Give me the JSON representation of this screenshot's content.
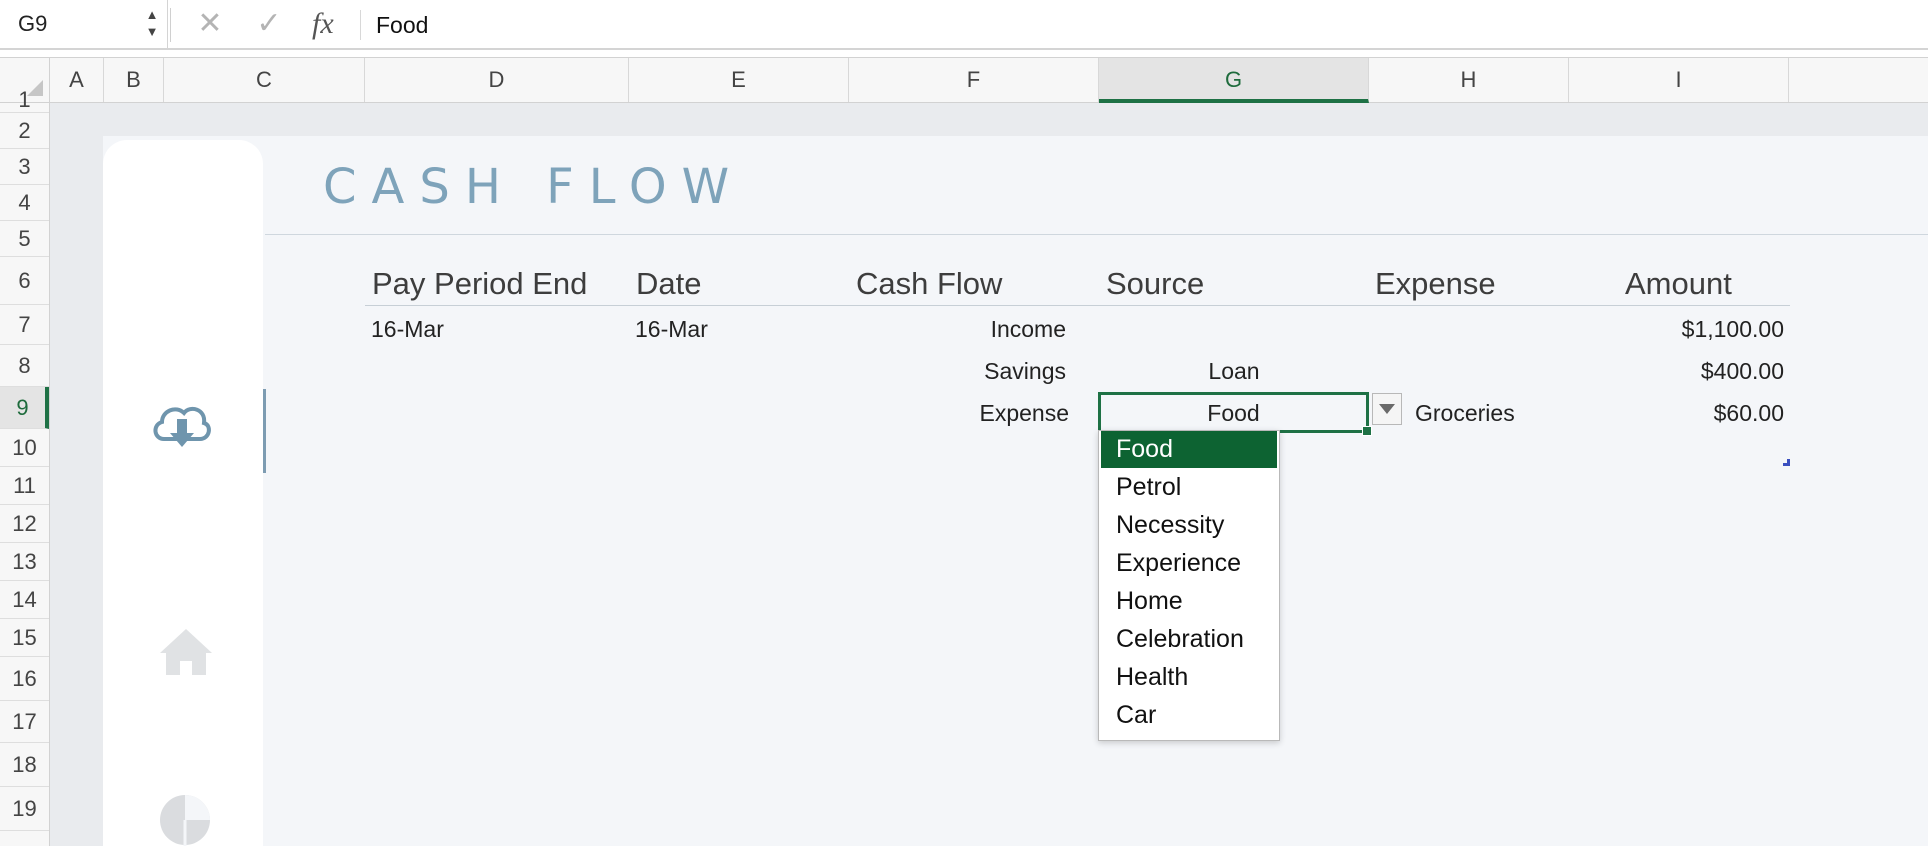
{
  "formula_bar": {
    "name_box": "G9",
    "cancel_icon": "close-icon",
    "enter_icon": "check-icon",
    "fx_label": "fx",
    "formula_value": "Food"
  },
  "columns": [
    "A",
    "B",
    "C",
    "D",
    "E",
    "F",
    "G",
    "H",
    "I"
  ],
  "active_column": "G",
  "rows": [
    "1",
    "2",
    "3",
    "4",
    "5",
    "6",
    "7",
    "8",
    "9",
    "10",
    "11",
    "12",
    "13",
    "14",
    "15",
    "16",
    "17",
    "18",
    "19"
  ],
  "active_row": "9",
  "sheet": {
    "title": "CASH FLOW",
    "headers": {
      "pay_period_end": "Pay Period End",
      "date": "Date",
      "cash_flow": "Cash Flow",
      "source": "Source",
      "expense": "Expense",
      "amount": "Amount"
    },
    "rows": [
      {
        "pay_period_end": "16-Mar",
        "date": "16-Mar",
        "cash_flow": "Income",
        "source": "",
        "expense": "",
        "amount": "$1,100.00"
      },
      {
        "pay_period_end": "",
        "date": "",
        "cash_flow": "Savings",
        "source": "Loan",
        "expense": "",
        "amount": "$400.00"
      },
      {
        "pay_period_end": "",
        "date": "",
        "cash_flow": "Expense",
        "source": "Food",
        "expense": "Groceries",
        "amount": "$60.00"
      }
    ]
  },
  "dropdown": {
    "selected": "Food",
    "options": [
      "Food",
      "Petrol",
      "Necessity",
      "Experience",
      "Home",
      "Celebration",
      "Health",
      "Car"
    ]
  },
  "sidebar_icons": [
    "cloud-download-icon",
    "home-icon",
    "pie-chart-icon"
  ],
  "colors": {
    "accent_green": "#1e7145",
    "title_blue": "#7ea3ba",
    "dropdown_selected": "#0d6332"
  }
}
